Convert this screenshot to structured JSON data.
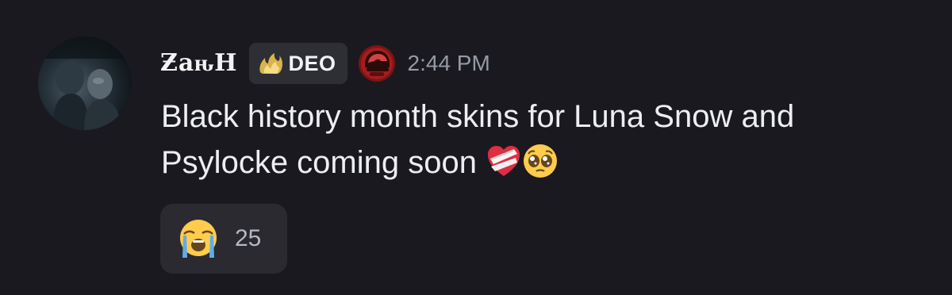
{
  "message": {
    "author": {
      "username": "ƵaԋH",
      "avatar_icon": "user-avatar-icon"
    },
    "role_tag": {
      "icon": "golden-flame-icon",
      "label": "DEO"
    },
    "clan_icon": "red-helmet-icon",
    "timestamp": "2:44 PM",
    "content": {
      "line1": "Black history month skins for Luna Snow and",
      "line2": "Psylocke coming soon",
      "emojis": [
        "mending-heart-emoji",
        "pleading-face-emoji"
      ]
    },
    "reactions": [
      {
        "emoji": "loudly-crying-face-emoji",
        "count": "25"
      }
    ]
  },
  "colors": {
    "background": "#1a191f",
    "text": "#eceef1",
    "muted": "#949ba4",
    "tag_bg": "#2e2f35",
    "reaction_bg": "#2a2a30"
  }
}
